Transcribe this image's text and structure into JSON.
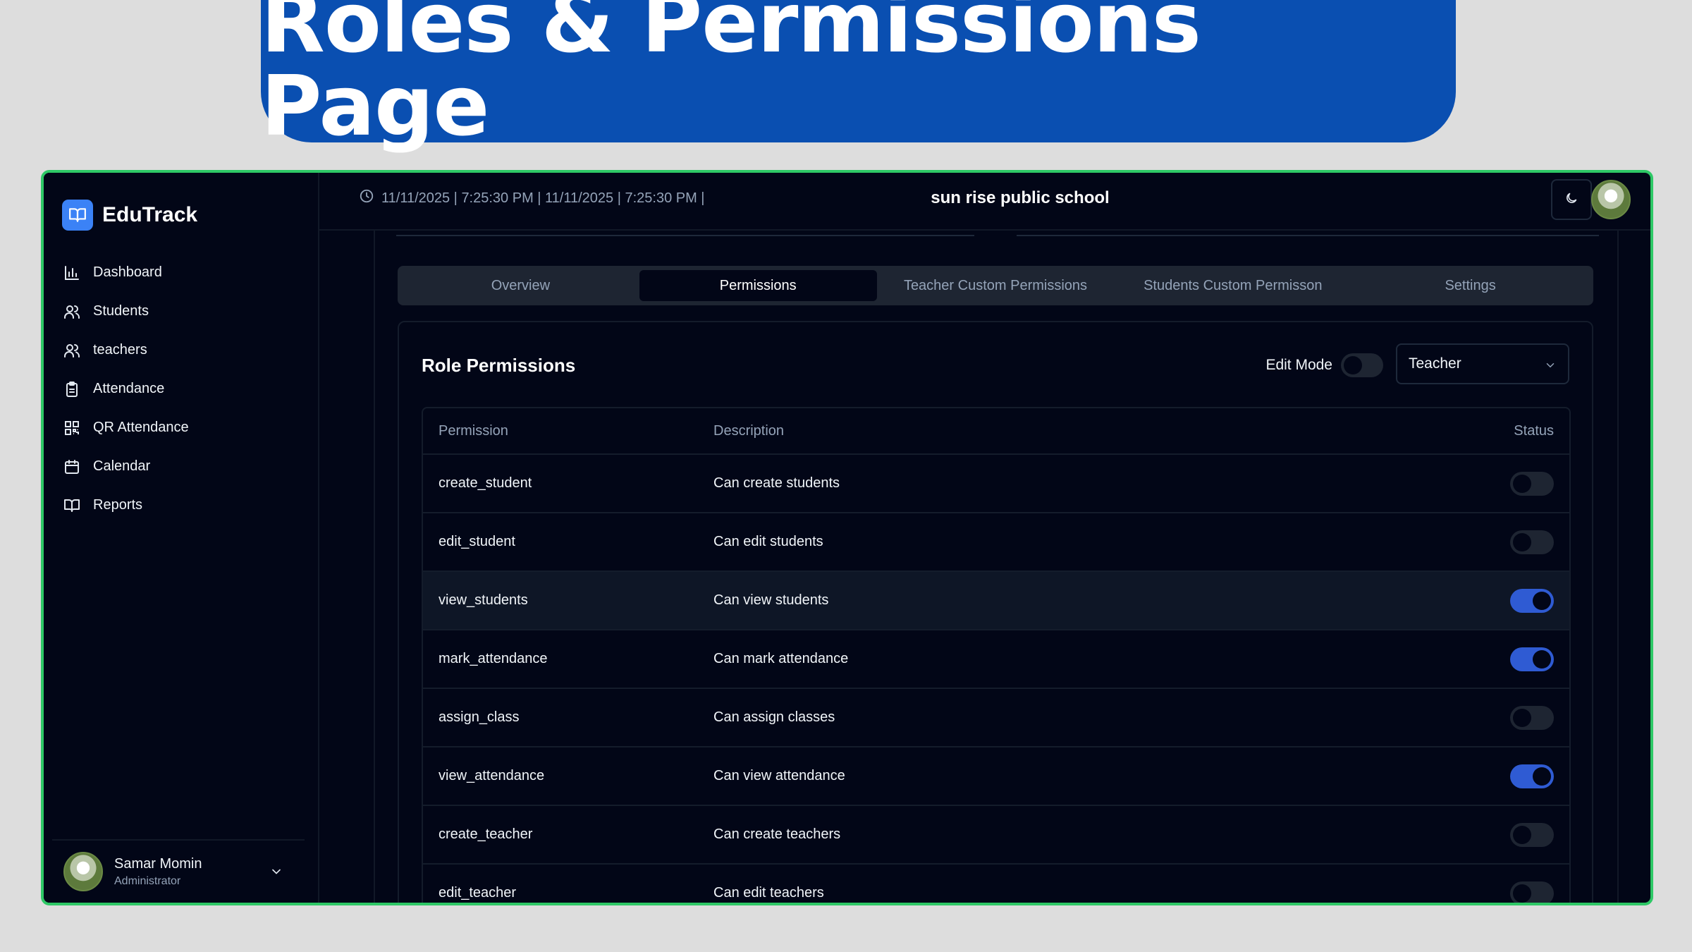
{
  "banner": {
    "title": "Roles & Permissions Page"
  },
  "app": {
    "brand": "EduTrack",
    "nav": [
      {
        "label": "Dashboard",
        "icon": "bar-chart-icon"
      },
      {
        "label": "Students",
        "icon": "users-icon"
      },
      {
        "label": "teachers",
        "icon": "users-icon"
      },
      {
        "label": "Attendance",
        "icon": "clipboard-icon"
      },
      {
        "label": "QR Attendance",
        "icon": "qr-code-icon"
      },
      {
        "label": "Calendar",
        "icon": "calendar-icon"
      },
      {
        "label": "Reports",
        "icon": "book-open-icon"
      }
    ],
    "user": {
      "name": "Samar Momin",
      "role": "Administrator"
    },
    "topbar": {
      "datetime": "11/11/2025 | 7:25:30 PM | 11/11/2025 | 7:25:30 PM |",
      "school": "sun rise public school"
    },
    "tabs": [
      {
        "label": "Overview",
        "active": false
      },
      {
        "label": "Permissions",
        "active": true
      },
      {
        "label": "Teacher Custom Permissions",
        "active": false
      },
      {
        "label": "Students Custom Permisson",
        "active": false
      },
      {
        "label": "Settings",
        "active": false
      }
    ],
    "panel": {
      "title": "Role Permissions",
      "edit_mode_label": "Edit Mode",
      "edit_mode_on": false,
      "role_selected": "Teacher"
    },
    "table": {
      "headers": {
        "permission": "Permission",
        "description": "Description",
        "status": "Status"
      },
      "rows": [
        {
          "permission": "create_student",
          "description": "Can create students",
          "enabled": false
        },
        {
          "permission": "edit_student",
          "description": "Can edit students",
          "enabled": false
        },
        {
          "permission": "view_students",
          "description": "Can view students",
          "enabled": true
        },
        {
          "permission": "mark_attendance",
          "description": "Can mark attendance",
          "enabled": true
        },
        {
          "permission": "assign_class",
          "description": "Can assign classes",
          "enabled": false
        },
        {
          "permission": "view_attendance",
          "description": "Can view attendance",
          "enabled": true
        },
        {
          "permission": "create_teacher",
          "description": "Can create teachers",
          "enabled": false
        },
        {
          "permission": "edit_teacher",
          "description": "Can edit teachers",
          "enabled": false
        }
      ]
    },
    "colors": {
      "accent": "#3b82f6",
      "toggle_on": "#2f5bd3",
      "banner": "#0a4fb1",
      "frame": "#2ec866"
    }
  }
}
